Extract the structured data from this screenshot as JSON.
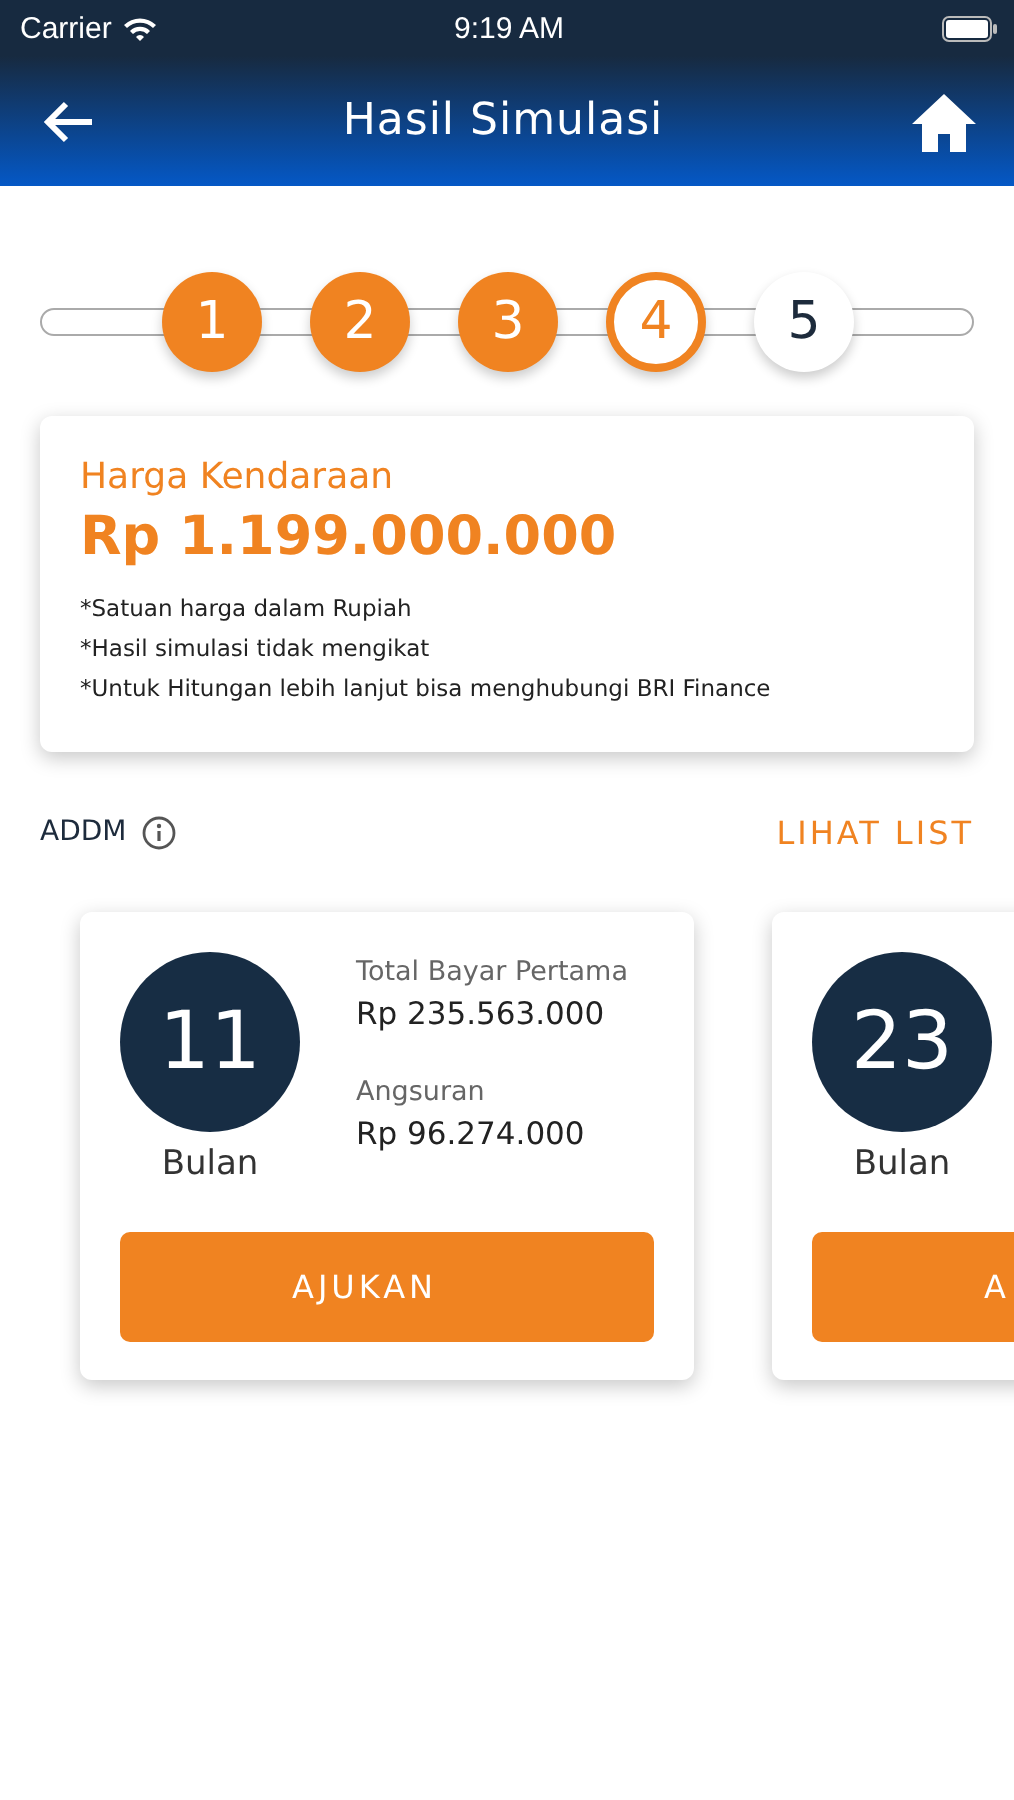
{
  "status_bar": {
    "carrier": "Carrier",
    "time": "9:19 AM"
  },
  "header": {
    "title": "Hasil Simulasi"
  },
  "steps": [
    {
      "label": "1",
      "done": true,
      "selected": false
    },
    {
      "label": "2",
      "done": true,
      "selected": false
    },
    {
      "label": "3",
      "done": true,
      "selected": false
    },
    {
      "label": "4",
      "done": false,
      "selected": true
    },
    {
      "label": "5",
      "done": false,
      "selected": false
    }
  ],
  "price_card": {
    "title": "Harga Kendaraan",
    "price": "Rp 1.199.000.000",
    "notes": [
      "*Satuan harga dalam Rupiah",
      "*Hasil simulasi tidak mengikat",
      "*Untuk Hitungan lebih lanjut bisa menghubungi BRI Finance"
    ]
  },
  "section": {
    "label": "ADDM",
    "link": "LIHAT LIST"
  },
  "options": [
    {
      "months": "11",
      "unit": "Bulan",
      "details": [
        {
          "label": "Total Bayar Pertama",
          "value": "Rp 235.563.000"
        },
        {
          "label": "Angsuran",
          "value": "Rp 96.274.000"
        }
      ],
      "button": "AJUKAN"
    },
    {
      "months": "23",
      "unit": "Bulan",
      "button": "A"
    }
  ]
}
